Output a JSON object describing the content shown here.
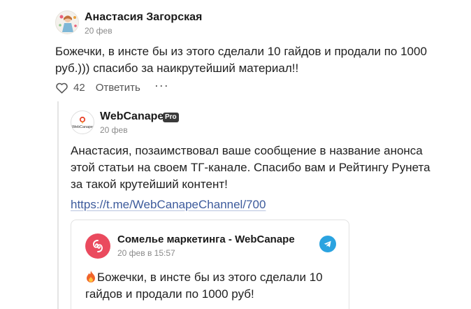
{
  "comment": {
    "author": "Анастасия Загорская",
    "date": "20 фев",
    "text": "Божечки, в инсте бы из этого сделали 10 гайдов и продали по 1000 руб.))) спасибо за наикрутейший материал!!",
    "likes": "42",
    "reply_label": "Ответить",
    "more_label": "···",
    "avatar_icon": "illustrated-girl-avatar",
    "like_icon": "heart-outline-icon"
  },
  "reply": {
    "author": "WebCanape",
    "badge": "Pro",
    "date": "20 фев",
    "text": "Анастасия, позаимствовал ваше сообщение в название анонса этой статьи на своем ТГ-канале. Спасибо вам и Рейтингу Рунета за такой крутейший контент!",
    "link": "https://t.me/WebCanapeChannel/700",
    "logo_text": "WebCanape",
    "embed": {
      "title": "Сомелье маркетинга - WebCanape",
      "date": "20 фев в 15:57",
      "text": "Божечки, в инсте бы из этого сделали 10 гайдов и продали по 1000 руб!",
      "avatar_icon": "red-spiral-logo-icon",
      "source_icon": "telegram-icon"
    }
  },
  "colors": {
    "link": "#3d5b9c",
    "muted": "#8a8a8a",
    "telegram": "#2aa3e0",
    "embed_avatar": "#ea4a5e",
    "badge_bg": "#3a3a3a"
  }
}
